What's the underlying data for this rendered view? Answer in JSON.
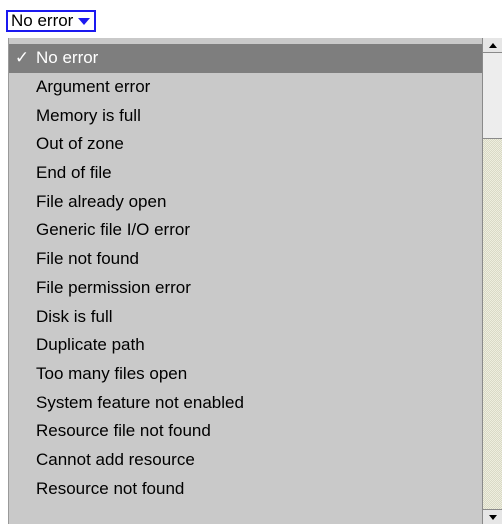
{
  "popup": {
    "label": "No error",
    "accent_color": "#1b19f0"
  },
  "menu": {
    "selected_index": 0,
    "check_glyph": "✓",
    "items": [
      {
        "label": "No error"
      },
      {
        "label": "Argument error"
      },
      {
        "label": "Memory is full"
      },
      {
        "label": "Out of zone"
      },
      {
        "label": "End of file"
      },
      {
        "label": "File already open"
      },
      {
        "label": "Generic file I/O error"
      },
      {
        "label": "File not found"
      },
      {
        "label": "File permission error"
      },
      {
        "label": "Disk is full"
      },
      {
        "label": "Duplicate path"
      },
      {
        "label": "Too many files open"
      },
      {
        "label": "System feature not enabled"
      },
      {
        "label": "Resource file not found"
      },
      {
        "label": "Cannot add resource"
      },
      {
        "label": "Resource not found"
      }
    ],
    "colors": {
      "background": "#c9c9c9",
      "selected_background": "#7e7e7e",
      "selected_text": "#ffffff"
    }
  },
  "scrollbar": {
    "up_icon": "arrow-up",
    "down_icon": "arrow-down"
  }
}
